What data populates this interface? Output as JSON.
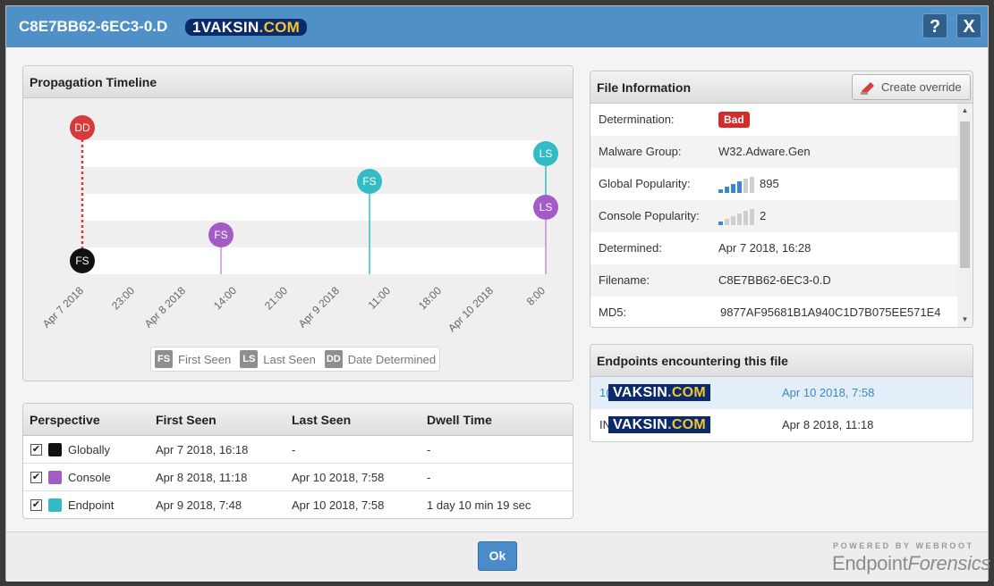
{
  "title": "C8E7BB62-6EC3-0.D",
  "watermark": {
    "prefix": "1",
    "text_a": "VAKSIN",
    "text_b": ".COM"
  },
  "help_label": "?",
  "close_label": "X",
  "timeline": {
    "header": "Propagation Timeline",
    "ticks": [
      "Apr 7 2018",
      "23:00",
      "Apr 8 2018",
      "14:00",
      "21:00",
      "Apr 9 2018",
      "11:00",
      "18:00",
      "Apr 10 2018",
      "8:00"
    ],
    "markers": [
      {
        "code": "DD",
        "color": "#d63a3a",
        "label": "Date Determined"
      },
      {
        "code": "FS",
        "color": "#111111",
        "label": "First Seen (Globally)"
      },
      {
        "code": "FS",
        "color": "#a35bc5",
        "label": "First Seen (Console)"
      },
      {
        "code": "FS",
        "color": "#33bcc4",
        "label": "First Seen (Endpoint)"
      },
      {
        "code": "LS",
        "color": "#33bcc4",
        "label": "Last Seen (Endpoint)"
      },
      {
        "code": "LS",
        "color": "#a35bc5",
        "label": "Last Seen (Console)"
      }
    ],
    "legend": [
      {
        "code": "FS",
        "label": "First Seen"
      },
      {
        "code": "LS",
        "label": "Last Seen"
      },
      {
        "code": "DD",
        "label": "Date Determined"
      }
    ]
  },
  "perspective": {
    "headers": [
      "Perspective",
      "First Seen",
      "Last Seen",
      "Dwell Time"
    ],
    "rows": [
      {
        "name": "Globally",
        "color": "#111111",
        "first": "Apr 7 2018, 16:18",
        "last": "-",
        "dwell": "-"
      },
      {
        "name": "Console",
        "color": "#a35bc5",
        "first": "Apr 8 2018, 11:18",
        "last": "Apr 10 2018, 7:58",
        "dwell": "-"
      },
      {
        "name": "Endpoint",
        "color": "#33bcc4",
        "first": "Apr 9 2018, 7:48",
        "last": "Apr 10 2018, 7:58",
        "dwell": "1 day 10 min 19 sec"
      }
    ]
  },
  "file_info": {
    "header": "File Information",
    "override_label": "Create override",
    "determination_label": "Determination:",
    "determination_value": "Bad",
    "malware_label": "Malware Group:",
    "malware_value": "W32.Adware.Gen",
    "global_pop_label": "Global Popularity:",
    "global_pop_value": "895",
    "global_pop_level": 4,
    "console_pop_label": "Console Popularity:",
    "console_pop_value": "2",
    "console_pop_level": 1,
    "determined_label": "Determined:",
    "determined_value": "Apr 7 2018, 16:28",
    "filename_label": "Filename:",
    "filename_value": "C8E7BB62-6EC3-0.D",
    "md5_label": "MD5:",
    "md5_value": "9877AF95681B1A940C1D7B075EE571E4"
  },
  "endpoints": {
    "header": "Endpoints encountering this file",
    "rows": [
      {
        "prefix": "1(",
        "date": "Apr 10 2018, 7:58",
        "selected": true
      },
      {
        "prefix": "IN",
        "date": "Apr 8 2018, 11:18",
        "selected": false
      }
    ]
  },
  "footer": {
    "ok_label": "Ok",
    "powered": "POWERED BY WEBROOT",
    "brand_a": "Endpoint",
    "brand_b": "Forensics"
  },
  "colors": {
    "titlebar": "#4f90c8",
    "bad": "#d62b2b",
    "teal": "#33bcc4",
    "purple": "#a35bc5",
    "red": "#d63a3a"
  }
}
